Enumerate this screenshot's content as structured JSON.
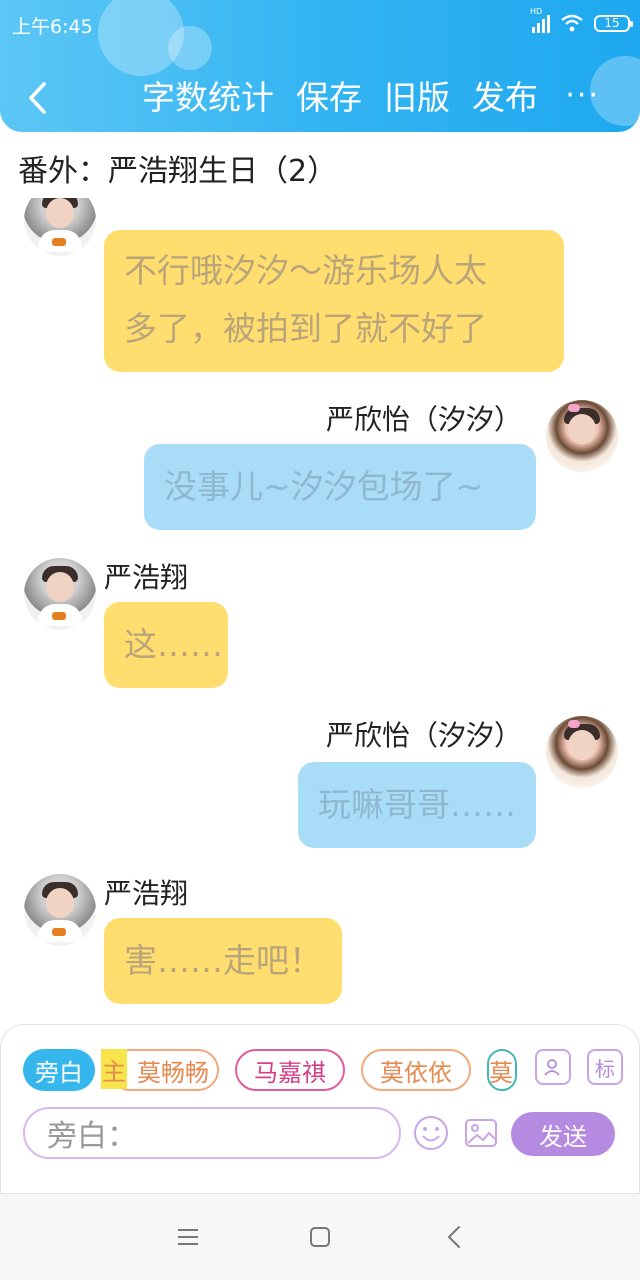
{
  "status_bar": {
    "time": "上午6:45",
    "network": "HD",
    "battery": "15"
  },
  "header": {
    "back_icon": "chevron-left-icon",
    "actions": [
      "字数统计",
      "保存",
      "旧版",
      "发布"
    ],
    "more": "···"
  },
  "chapter": {
    "title": "番外：严浩翔生日（2）"
  },
  "messages": [
    {
      "side": "left",
      "sender": "",
      "text_line1": "不行哦汐汐～游乐场人太",
      "text_line2": "多了，被拍到了就不好了"
    },
    {
      "side": "right",
      "sender": "严欣怡（汐汐）",
      "text": "没事儿~汐汐包场了~"
    },
    {
      "side": "left",
      "sender": "严浩翔",
      "text": "这……"
    },
    {
      "side": "right",
      "sender": "严欣怡（汐汐）",
      "text": "玩嘛哥哥……"
    },
    {
      "side": "left",
      "sender": "严浩翔",
      "text": "害……走吧！"
    }
  ],
  "input_panel": {
    "chips": [
      "旁白",
      "莫畅畅",
      "马嘉祺",
      "莫依依",
      "莫"
    ],
    "highlight_text": "主",
    "tag_button": "标",
    "placeholder": "旁白：",
    "send_label": "发送",
    "icons": [
      "person-card-icon",
      "emoji-icon",
      "image-icon"
    ]
  },
  "system_nav": {
    "icons": [
      "menu-icon",
      "home-square-icon",
      "back-triangle-icon"
    ]
  }
}
